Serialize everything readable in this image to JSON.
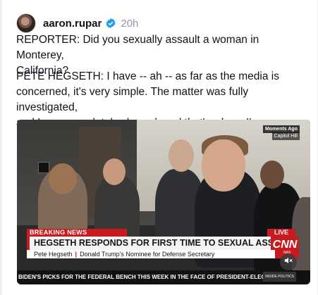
{
  "post": {
    "author": "aaron.rupar",
    "time": "20h",
    "line1": "REPORTER: Did you sexually assault a woman in Monterey,\nCalifornia?",
    "line2": "PETE HEGSETH: I have -- ah -- as far as the media is\nconcerned, it's very simple. The matter was fully investigated,\nand I was completely cleared, and that's where I'm gonna..."
  },
  "video": {
    "tag_top": "Moments Ago",
    "tag_location": "Capitol Hill",
    "breaking": "BREAKING NEWS",
    "live": "LIVE",
    "headline": "HEGSETH RESPONDS FOR FIRST TIME TO SEXUAL ASSAULT CLAIM",
    "sub_name": "Pete Hegseth",
    "sub_desc": "Donald Trump's Nominee for Defense Secretary",
    "network": "CNN",
    "network_sub": "NAS",
    "ticker": "BIDEN'S PICKS FOR THE FEDERAL BENCH THIS WEEK IN THE FACE OF PRESIDENT-ELEC",
    "ticker_tag": "INSIDE POLITICS"
  },
  "colors": {
    "accent_red": "#c81a1f",
    "verified_blue": "#1d9bf0"
  },
  "icons": {
    "verified": "verified-badge-icon",
    "mute": "speaker-muted-icon"
  }
}
